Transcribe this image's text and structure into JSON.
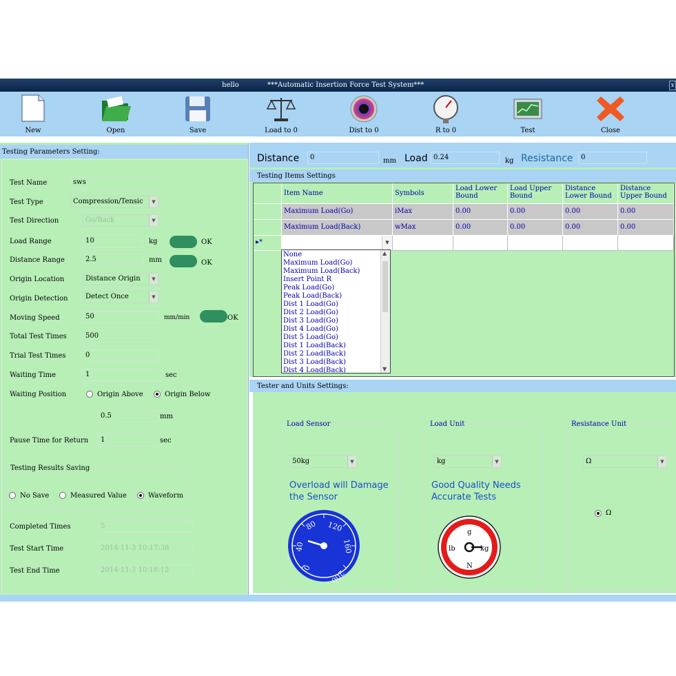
{
  "window": {
    "left_title": "hello",
    "title": "***Automatic Insertion Force Test System***",
    "close_glyph": "x"
  },
  "toolbar": [
    {
      "label": "New",
      "icon": "new-file-icon"
    },
    {
      "label": "Open",
      "icon": "folder-open-icon"
    },
    {
      "label": "Save",
      "icon": "floppy-disk-icon"
    },
    {
      "label": "Load to 0",
      "icon": "balance-scale-icon"
    },
    {
      "label": "Dist to 0",
      "icon": "color-wheel-icon"
    },
    {
      "label": "R to 0",
      "icon": "pressure-gauge-icon"
    },
    {
      "label": "Test",
      "icon": "monitor-chart-icon"
    },
    {
      "label": "Close",
      "icon": "close-x-icon"
    }
  ],
  "params": {
    "header": "Testing Parameters Setting:",
    "test_name_label": "Test Name",
    "test_name": "sws",
    "test_type_label": "Test Type",
    "test_type": "Compression/Tensic",
    "direction_label": "Test Direction",
    "direction": "Go/Back",
    "load_range_label": "Load Range",
    "load_range": "10",
    "load_range_unit": "kg",
    "ok1": "OK",
    "distance_range_label": "Distance Range",
    "distance_range": "2.5",
    "distance_range_unit": "mm",
    "ok2": "OK",
    "origin_location_label": "Origin Location",
    "origin_location": "Distance Origin",
    "origin_detection_label": "Origin Detection",
    "origin_detection": "Detect Once",
    "moving_speed_label": "Moving Speed",
    "moving_speed": "50",
    "moving_speed_unit": "mm/min",
    "ok3": "OK",
    "total_times_label": "Total Test Times",
    "total_times": "500",
    "trial_times_label": "Trial Test Times",
    "trial_times": "0",
    "waiting_time_label": "Waiting Time",
    "waiting_time": "1",
    "waiting_time_unit": "sec",
    "waiting_position_label": "Waiting Position",
    "origin_above": "Origin Above",
    "origin_below": "Origin Below",
    "waiting_offset": "0.5",
    "waiting_offset_unit": "mm",
    "pause_label": "Pause Time for Return",
    "pause": "1",
    "pause_unit": "sec",
    "saving_group": "Testing Results Saving",
    "no_save": "No Save",
    "measured": "Measured Value",
    "waveform": "Waveform",
    "completed_label": "Completed Times",
    "completed": "5",
    "start_label": "Test Start Time",
    "start": "2014-11-3 10:17:38",
    "end_label": "Test End Time",
    "end": "2014-11-3 10:18:12"
  },
  "readout": {
    "distance_label": "Distance",
    "distance": "0",
    "distance_unit": "mm",
    "load_label": "Load",
    "load": "0.24",
    "load_unit": "kg",
    "resistance_label": "Resistance",
    "resistance": "0"
  },
  "items": {
    "header": "Testing Items Settings",
    "columns": [
      "Item Name",
      "Symbols",
      "Load Lower Bound",
      "Load Upper Bound",
      "Distance Lower Bound",
      "Distance Upper Bound"
    ],
    "rows": [
      [
        "Maximum Load(Go)",
        "iMax",
        "0.00",
        "0.00",
        "0.00",
        "0.00"
      ],
      [
        "Maximum Load(Back)",
        "wMax",
        "0.00",
        "0.00",
        "0.00",
        "0.00"
      ]
    ],
    "new_row_marker": "▸*",
    "dropdown_options": [
      "None",
      "Maximum Load(Go)",
      "Maximum Load(Back)",
      "Insert Point R",
      "Peak Load(Go)",
      "Peak Load(Back)",
      "Dist 1 Load(Go)",
      "Dist 2 Load(Go)",
      "Dist 3 Load(Go)",
      "Dist 4 Load(Go)",
      "Dist 5 Load(Go)",
      "Dist 1 Load(Back)",
      "Dist 2 Load(Back)",
      "Dist 3 Load(Back)",
      "Dist 4 Load(Back)"
    ]
  },
  "tester": {
    "header": "Tester and Units Settings:",
    "load_sensor_group": "Load Sensor",
    "load_sensor": "50kg",
    "sensor_note": "Overload will Damage the Sensor",
    "load_unit_group": "Load Unit",
    "load_unit": "kg",
    "unit_note": "Good Quality Needs Accurate Tests",
    "resistance_group": "Resistance Unit",
    "resistance_unit": "Ω",
    "resistance_radio": "Ω",
    "gauge_ticks": [
      "0",
      "40",
      "80",
      "120",
      "160",
      "200"
    ],
    "unit_dial": {
      "top": "g",
      "left": "lb",
      "right": "kg",
      "bottom": "N"
    }
  }
}
